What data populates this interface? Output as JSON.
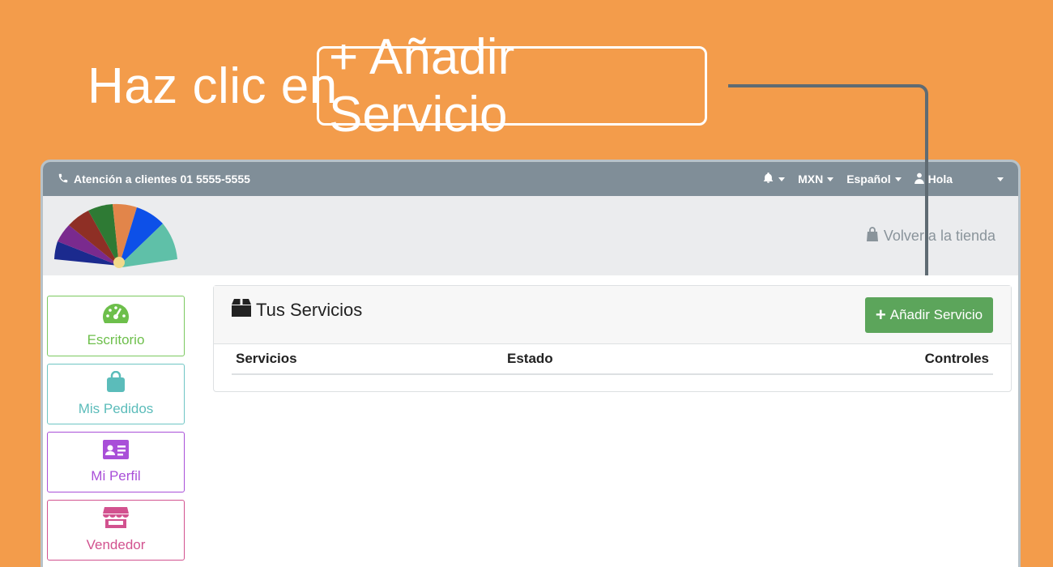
{
  "headline": {
    "prefix": "Haz clic en",
    "button_text": "+ Añadir Servicio"
  },
  "topbar": {
    "phone_text": "Atención a clientes 01 5555-5555",
    "currency": "MXN",
    "language": "Español",
    "user": "Hola"
  },
  "brand": {
    "back_link": "Volver a la tienda"
  },
  "sidebar": {
    "items": [
      {
        "label": "Escritorio",
        "icon": "dashboard-gauge-icon"
      },
      {
        "label": "Mis Pedidos",
        "icon": "shopping-bag-icon"
      },
      {
        "label": "Mi Perfil",
        "icon": "id-card-icon"
      },
      {
        "label": "Vendedor",
        "icon": "store-icon"
      }
    ]
  },
  "panel": {
    "title": "Tus Servicios",
    "add_button": "Añadir Servicio",
    "columns": [
      "Servicios",
      "Estado",
      "Controles"
    ]
  },
  "colors": {
    "background": "#F39C4B",
    "topbar": "#808E98",
    "add_button": "#5CA55B",
    "escritorio": "#6DBF4B",
    "pedidos": "#5BBCBA",
    "perfil": "#A94FD8",
    "vendedor": "#D2528F"
  }
}
